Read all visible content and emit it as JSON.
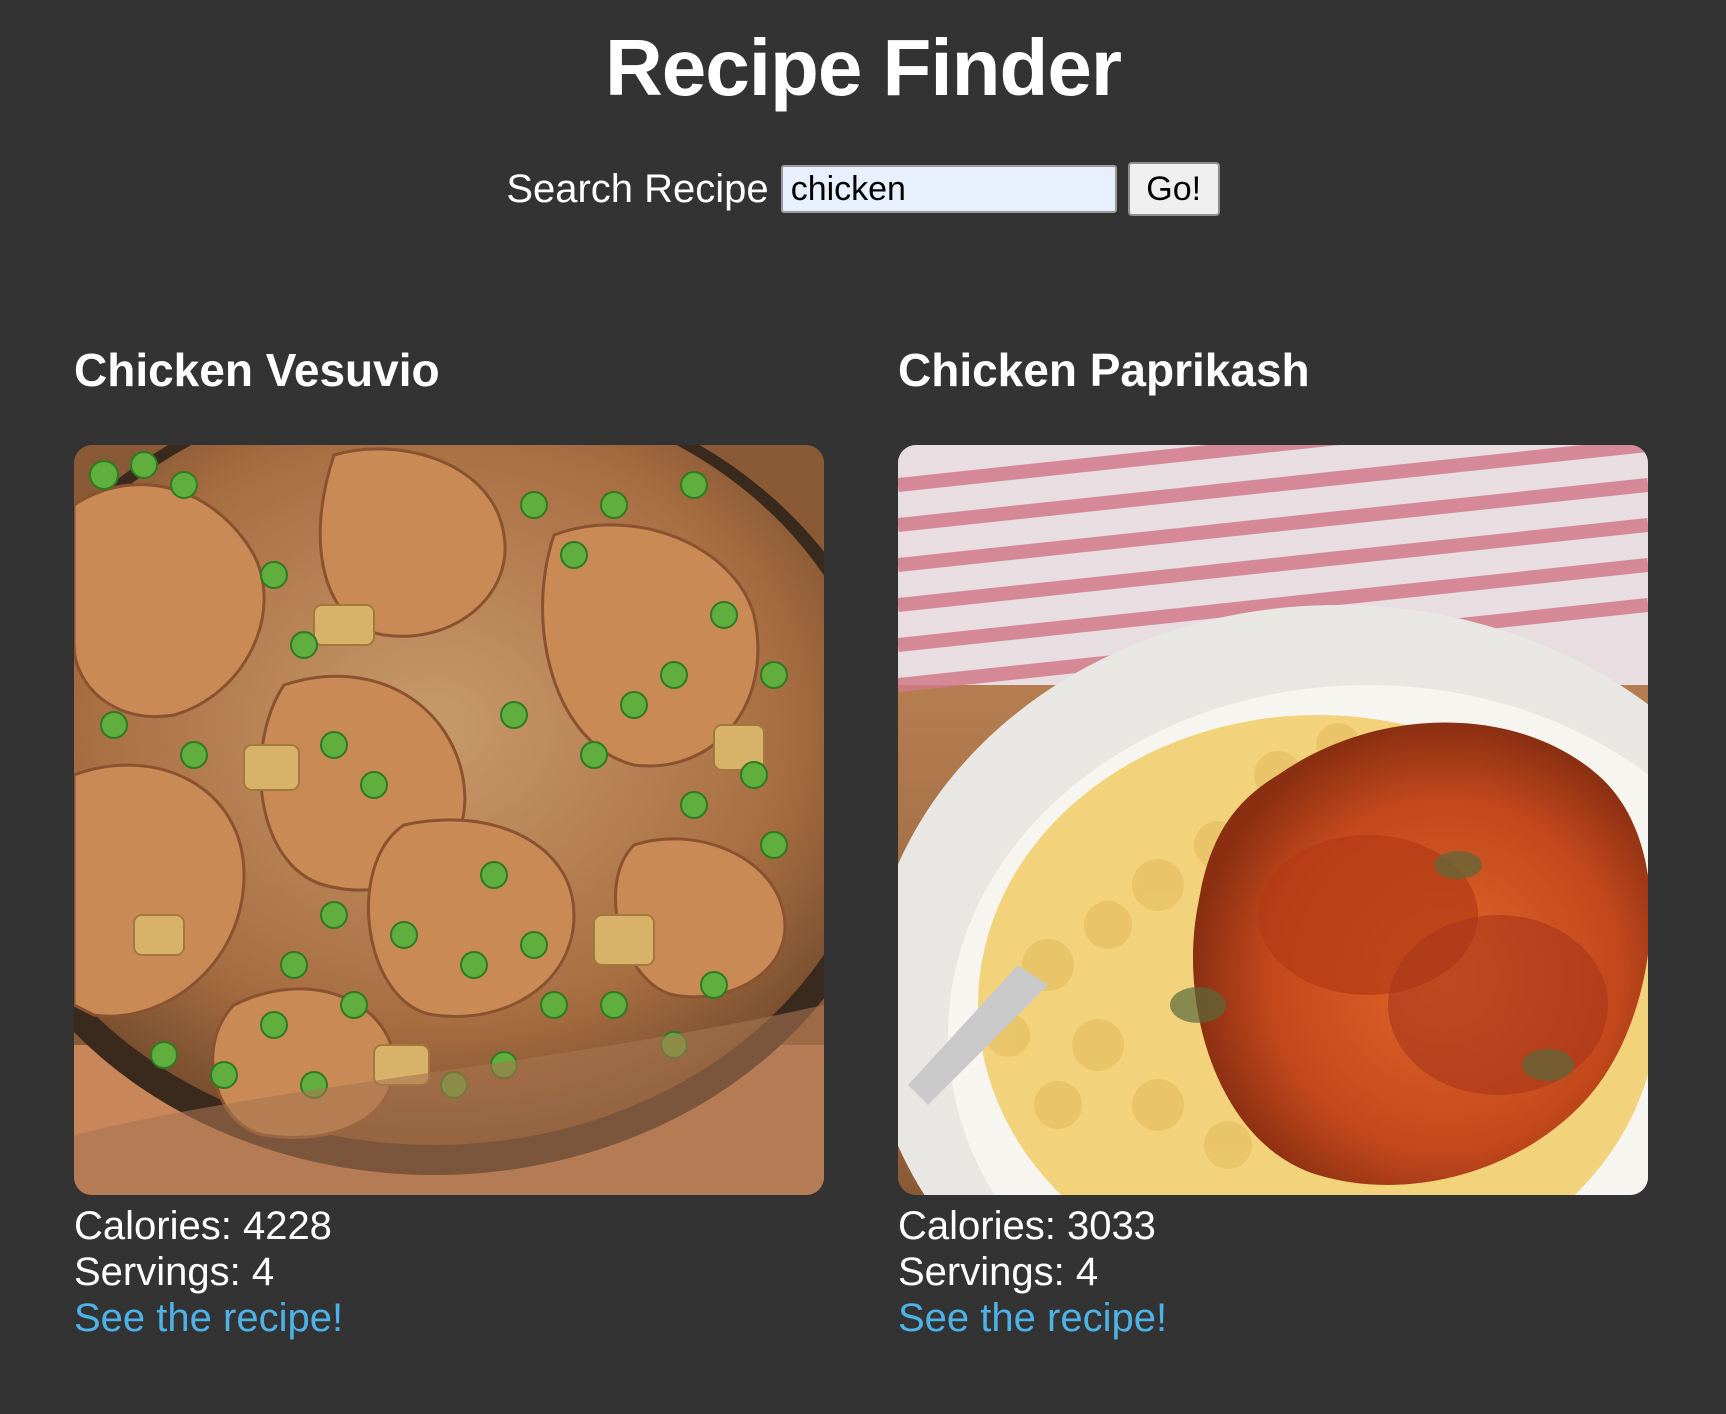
{
  "page": {
    "title": "Recipe Finder"
  },
  "search": {
    "label": "Search Recipe",
    "value": "chicken",
    "button_label": "Go!"
  },
  "recipes": [
    {
      "title": "Chicken Vesuvio",
      "calories_label": "Calories: 4228",
      "servings_label": "Servings: 4",
      "link_label": "See the recipe!"
    },
    {
      "title": "Chicken Paprikash",
      "calories_label": "Calories: 3033",
      "servings_label": "Servings: 4",
      "link_label": "See the recipe!"
    }
  ],
  "colors": {
    "background": "#333333",
    "text": "#ffffff",
    "link": "#4db3e6",
    "input_background": "#e8f0fe"
  }
}
